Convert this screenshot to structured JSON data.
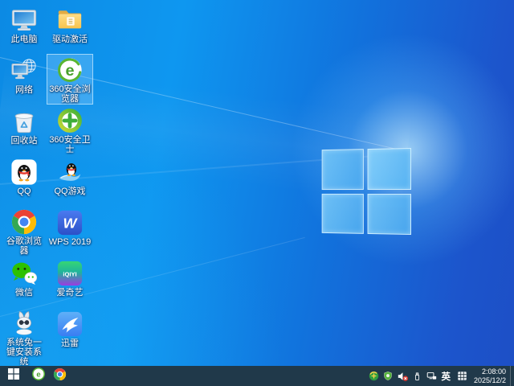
{
  "desktop": {
    "icons": [
      {
        "id": "this-pc",
        "icon": "this-pc-icon",
        "label": "此电脑",
        "selected": false
      },
      {
        "id": "driver-activate",
        "icon": "folder-icon",
        "label": "驱动激活",
        "selected": false
      },
      {
        "id": "network",
        "icon": "network-globe-icon",
        "label": "网络",
        "selected": false
      },
      {
        "id": "360-browser",
        "icon": "360-browser-e-icon",
        "label": "360安全浏览器",
        "selected": true
      },
      {
        "id": "recycle-bin",
        "icon": "recycle-bin-icon",
        "label": "回收站",
        "selected": false
      },
      {
        "id": "360-safeguard",
        "icon": "360-safeguard-icon",
        "label": "360安全卫士",
        "selected": false
      },
      {
        "id": "qq",
        "icon": "qq-penguin-icon",
        "label": "QQ",
        "selected": false
      },
      {
        "id": "qq-games",
        "icon": "qq-games-icon",
        "label": "QQ游戏",
        "selected": false
      },
      {
        "id": "chrome",
        "icon": "chrome-icon",
        "label": "谷歌浏览器",
        "selected": false
      },
      {
        "id": "wps-2019",
        "icon": "wps-icon",
        "label": "WPS 2019",
        "selected": false
      },
      {
        "id": "wechat",
        "icon": "wechat-icon",
        "label": "微信",
        "selected": false
      },
      {
        "id": "iqiyi",
        "icon": "iqiyi-icon",
        "label": "爱奇艺",
        "selected": false
      },
      {
        "id": "xitongtu",
        "icon": "rabbit-installer-icon",
        "label": "系统兔一键安装系统",
        "selected": false
      },
      {
        "id": "xunlei",
        "icon": "thunder-bird-icon",
        "label": "迅雷",
        "selected": false
      }
    ]
  },
  "taskbar": {
    "start": {
      "icon": "windows-start-icon"
    },
    "apps": [
      {
        "id": "360-browser",
        "icon": "360-browser-e-icon"
      },
      {
        "id": "chrome",
        "icon": "chrome-icon"
      }
    ],
    "tray": [
      {
        "icon": "360-antivirus-tray-icon"
      },
      {
        "icon": "360-shield-tray-icon"
      },
      {
        "icon": "volume-muted-icon"
      },
      {
        "icon": "usb-device-icon"
      },
      {
        "icon": "wired-network-icon"
      }
    ],
    "language_indicator": "英",
    "ime": {
      "icon": "ime-keyboard-grid-icon"
    },
    "clock": {
      "time": "2:08:00",
      "date": "2025/12/2"
    }
  },
  "colors": {
    "taskbar_bg": "#20394a",
    "wallpaper_bright": "#0e97f0",
    "wallpaper_dark": "#1d4fc6",
    "selection_highlight": "rgba(140,205,255,0.35)"
  }
}
